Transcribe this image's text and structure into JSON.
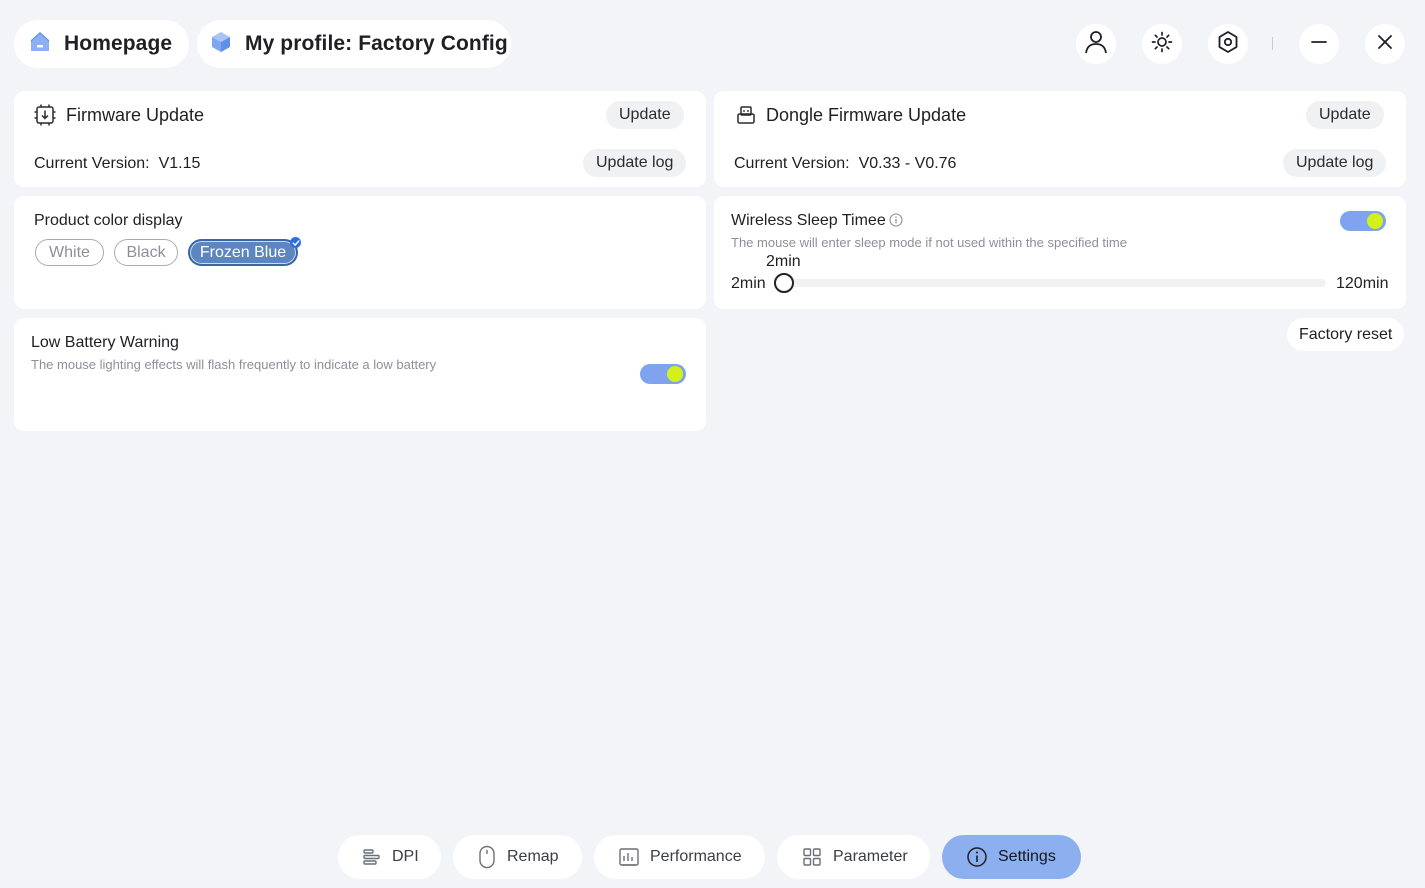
{
  "header": {
    "home_label": "Homepage",
    "profile_label": "My profile: Factory Config"
  },
  "firmware": {
    "title": "Firmware Update",
    "update_label": "Update",
    "version_label": "Current Version:",
    "version_value": "V1.15",
    "log_label": "Update log"
  },
  "dongle": {
    "title": "Dongle Firmware Update",
    "update_label": "Update",
    "version_label": "Current Version:",
    "version_value": "V0.33 - V0.76",
    "log_label": "Update log"
  },
  "color_display": {
    "title": "Product color display",
    "options": [
      "White",
      "Black",
      "Frozen Blue"
    ],
    "selected": "Frozen Blue"
  },
  "sleep": {
    "title": "Wireless Sleep Timee",
    "description": "The mouse will enter sleep mode if not used within the specified time",
    "enabled": true,
    "current": "2min",
    "min": "2min",
    "max": "120min",
    "level": 0
  },
  "battery": {
    "title": "Low Battery Warning",
    "description": "The mouse lighting effects will flash frequently to indicate a low battery",
    "enabled": true
  },
  "factory_reset_label": "Factory reset",
  "nav": {
    "items": [
      "DPI",
      "Remap",
      "Performance",
      "Parameter",
      "Settings"
    ],
    "active": "Settings"
  },
  "colors": {
    "accent": "#8cafef",
    "toggle_track": "#7fa3ef",
    "toggle_knob": "#d4f01a",
    "chip_selected": "#5b86c0"
  },
  "icons": [
    "home-icon",
    "cube-icon",
    "user-icon",
    "brightness-icon",
    "settings-hex-icon",
    "minimize-icon",
    "close-icon",
    "chip-icon",
    "dongle-icon",
    "info-icon",
    "dpi-icon",
    "mouse-icon",
    "chart-icon",
    "grid-icon",
    "info-circle-icon"
  ]
}
